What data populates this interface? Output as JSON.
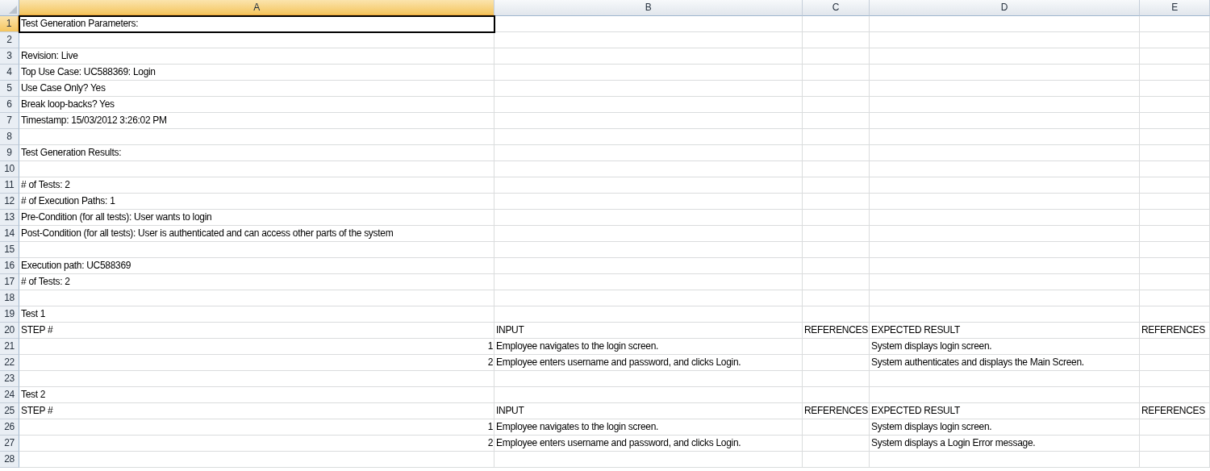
{
  "columns": [
    {
      "label": "A",
      "selected": true
    },
    {
      "label": "B",
      "selected": false
    },
    {
      "label": "C",
      "selected": false
    },
    {
      "label": "D",
      "selected": false
    },
    {
      "label": "E",
      "selected": false
    }
  ],
  "rows": [
    {
      "number": "1",
      "selected": true,
      "cells": [
        {
          "text": "Test Generation Parameters:",
          "kind": "text",
          "selected": true
        },
        null,
        null,
        null,
        null
      ]
    },
    {
      "number": "2",
      "selected": false,
      "cells": [
        null,
        null,
        null,
        null,
        null
      ]
    },
    {
      "number": "3",
      "selected": false,
      "cells": [
        {
          "text": "Revision: Live",
          "kind": "text",
          "selected": false
        },
        null,
        null,
        null,
        null
      ]
    },
    {
      "number": "4",
      "selected": false,
      "cells": [
        {
          "text": "Top Use Case: UC588369: Login",
          "kind": "text",
          "selected": false
        },
        null,
        null,
        null,
        null
      ]
    },
    {
      "number": "5",
      "selected": false,
      "cells": [
        {
          "text": "Use Case Only? Yes",
          "kind": "text",
          "selected": false
        },
        null,
        null,
        null,
        null
      ]
    },
    {
      "number": "6",
      "selected": false,
      "cells": [
        {
          "text": "Break loop-backs? Yes",
          "kind": "text",
          "selected": false
        },
        null,
        null,
        null,
        null
      ]
    },
    {
      "number": "7",
      "selected": false,
      "cells": [
        {
          "text": "Timestamp: 15/03/2012 3:26:02 PM",
          "kind": "text",
          "selected": false
        },
        null,
        null,
        null,
        null
      ]
    },
    {
      "number": "8",
      "selected": false,
      "cells": [
        null,
        null,
        null,
        null,
        null
      ]
    },
    {
      "number": "9",
      "selected": false,
      "cells": [
        {
          "text": "Test Generation Results:",
          "kind": "text",
          "selected": false
        },
        null,
        null,
        null,
        null
      ]
    },
    {
      "number": "10",
      "selected": false,
      "cells": [
        null,
        null,
        null,
        null,
        null
      ]
    },
    {
      "number": "11",
      "selected": false,
      "cells": [
        {
          "text": "# of Tests: 2",
          "kind": "text",
          "selected": false
        },
        null,
        null,
        null,
        null
      ]
    },
    {
      "number": "12",
      "selected": false,
      "cells": [
        {
          "text": "# of Execution Paths: 1",
          "kind": "text",
          "selected": false
        },
        null,
        null,
        null,
        null
      ]
    },
    {
      "number": "13",
      "selected": false,
      "cells": [
        {
          "text": "Pre-Condition (for all tests): User wants to login",
          "kind": "text",
          "selected": false
        },
        null,
        null,
        null,
        null
      ]
    },
    {
      "number": "14",
      "selected": false,
      "cells": [
        {
          "text": "Post-Condition (for all tests): User is authenticated and can access other parts of the system",
          "kind": "text",
          "selected": false
        },
        null,
        null,
        null,
        null
      ]
    },
    {
      "number": "15",
      "selected": false,
      "cells": [
        null,
        null,
        null,
        null,
        null
      ]
    },
    {
      "number": "16",
      "selected": false,
      "cells": [
        {
          "text": "Execution path: UC588369",
          "kind": "text",
          "selected": false
        },
        null,
        null,
        null,
        null
      ]
    },
    {
      "number": "17",
      "selected": false,
      "cells": [
        {
          "text": "# of Tests: 2",
          "kind": "text",
          "selected": false
        },
        null,
        null,
        null,
        null
      ]
    },
    {
      "number": "18",
      "selected": false,
      "cells": [
        null,
        null,
        null,
        null,
        null
      ]
    },
    {
      "number": "19",
      "selected": false,
      "cells": [
        {
          "text": "Test 1",
          "kind": "text",
          "selected": false
        },
        null,
        null,
        null,
        null
      ]
    },
    {
      "number": "20",
      "selected": false,
      "cells": [
        {
          "text": "STEP #",
          "kind": "text",
          "selected": false
        },
        {
          "text": "INPUT",
          "kind": "text",
          "selected": false
        },
        {
          "text": "REFERENCES",
          "kind": "text",
          "selected": false
        },
        {
          "text": "EXPECTED RESULT",
          "kind": "text",
          "selected": false
        },
        {
          "text": "REFERENCES",
          "kind": "text",
          "selected": false
        }
      ]
    },
    {
      "number": "21",
      "selected": false,
      "cells": [
        {
          "text": "1",
          "kind": "number",
          "selected": false
        },
        {
          "text": "Employee navigates to the login screen.",
          "kind": "text",
          "selected": false
        },
        null,
        {
          "text": "System displays login screen.",
          "kind": "text",
          "selected": false
        },
        null
      ]
    },
    {
      "number": "22",
      "selected": false,
      "cells": [
        {
          "text": "2",
          "kind": "number",
          "selected": false
        },
        {
          "text": "Employee enters username and password, and clicks Login.",
          "kind": "text",
          "selected": false
        },
        null,
        {
          "text": "System authenticates and displays the Main Screen.",
          "kind": "text",
          "selected": false
        },
        null
      ]
    },
    {
      "number": "23",
      "selected": false,
      "cells": [
        null,
        null,
        null,
        null,
        null
      ]
    },
    {
      "number": "24",
      "selected": false,
      "cells": [
        {
          "text": "Test 2",
          "kind": "text",
          "selected": false
        },
        null,
        null,
        null,
        null
      ]
    },
    {
      "number": "25",
      "selected": false,
      "cells": [
        {
          "text": "STEP #",
          "kind": "text",
          "selected": false
        },
        {
          "text": "INPUT",
          "kind": "text",
          "selected": false
        },
        {
          "text": "REFERENCES",
          "kind": "text",
          "selected": false
        },
        {
          "text": "EXPECTED RESULT",
          "kind": "text",
          "selected": false
        },
        {
          "text": "REFERENCES",
          "kind": "text",
          "selected": false
        }
      ]
    },
    {
      "number": "26",
      "selected": false,
      "cells": [
        {
          "text": "1",
          "kind": "number",
          "selected": false
        },
        {
          "text": "Employee navigates to the login screen.",
          "kind": "text",
          "selected": false
        },
        null,
        {
          "text": "System displays login screen.",
          "kind": "text",
          "selected": false
        },
        null
      ]
    },
    {
      "number": "27",
      "selected": false,
      "cells": [
        {
          "text": "2",
          "kind": "number",
          "selected": false
        },
        {
          "text": "Employee enters username and password, and clicks Login.",
          "kind": "text",
          "selected": false
        },
        null,
        {
          "text": "System displays a Login Error message.",
          "kind": "text",
          "selected": false
        },
        null
      ]
    },
    {
      "number": "28",
      "selected": false,
      "cells": [
        null,
        null,
        null,
        null,
        null
      ]
    }
  ]
}
